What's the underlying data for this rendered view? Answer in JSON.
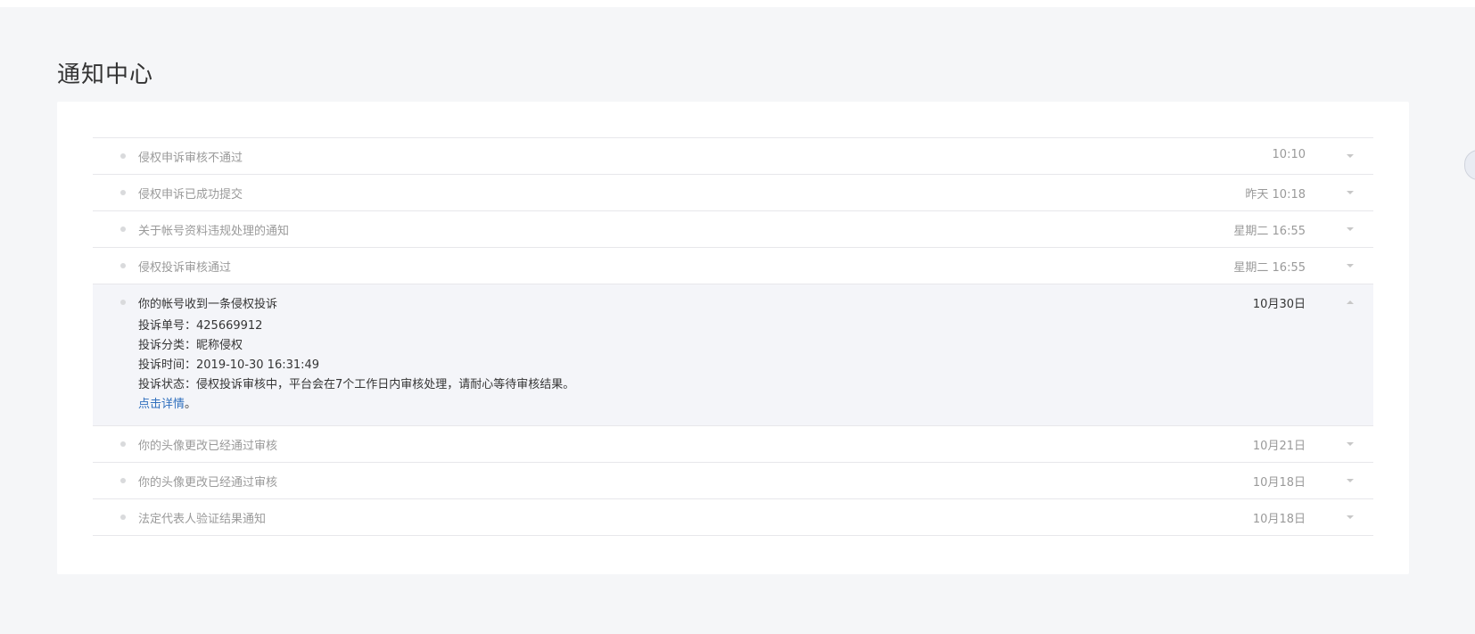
{
  "page": {
    "title": "通知中心"
  },
  "notifications": [
    {
      "title": "侵权申诉审核不通过",
      "time": "10:10"
    },
    {
      "title": "侵权申诉已成功提交",
      "time": "昨天 10:18"
    },
    {
      "title": "关于帐号资料违规处理的通知",
      "time": "星期二 16:55"
    },
    {
      "title": "侵权投诉审核通过",
      "time": "星期二 16:55"
    },
    {
      "title": "你的帐号收到一条侵权投诉",
      "time": "10月30日"
    },
    {
      "title": "你的头像更改已经通过审核",
      "time": "10月21日"
    },
    {
      "title": "你的头像更改已经通过审核",
      "time": "10月18日"
    },
    {
      "title": "法定代表人验证结果通知",
      "time": "10月18日"
    }
  ],
  "expanded_detail": {
    "line1": "投诉单号：425669912",
    "line2": "投诉分类：昵称侵权",
    "line3": "投诉时间：2019-10-30 16:31:49",
    "line4": "投诉状态：侵权投诉审核中，平台会在7个工作日内审核处理，请耐心等待审核结果。",
    "link_text": "点击详情",
    "link_suffix": "。"
  },
  "colors": {
    "background": "#f5f6f8",
    "card": "#ffffff",
    "expanded_row": "#f4f5f9",
    "link": "#2f6fbd",
    "muted_text": "#9a9a9a",
    "dark_text": "#353535"
  },
  "icons": {
    "row_bullet": "dot-icon",
    "collapsed_arrow": "caret-down-icon",
    "expanded_arrow": "caret-up-icon"
  }
}
